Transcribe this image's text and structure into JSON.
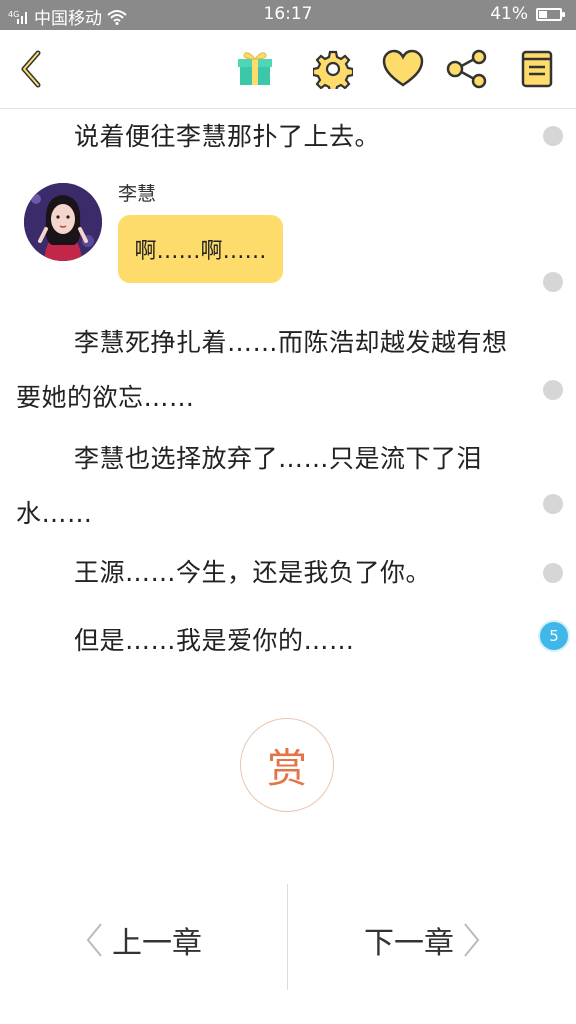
{
  "status_bar": {
    "signal_text": "4G",
    "carrier": "中国移动",
    "time": "16:17",
    "battery_percent": "41%",
    "battery_level": 0.41
  },
  "toolbar": {
    "icons": [
      "back-icon",
      "gift-icon",
      "settings-gear-icon",
      "heart-icon",
      "share-icon",
      "book-icon"
    ],
    "accent_color": "#fddc6b"
  },
  "story": {
    "paragraphs": [
      "说着便往李慧那扑了上去。",
      "李慧死挣扎着……而陈浩却越发越有想要她的欲忘……",
      "李慧也选择放弃了……只是流下了泪水……",
      "王源……今生，还是我负了你。",
      "但是……我是爱你的……"
    ],
    "dialogue": {
      "speaker": "李慧",
      "message": "啊……啊……"
    },
    "last_comment_count": "5"
  },
  "reward": {
    "label": "赏"
  },
  "chapter_nav": {
    "prev_label": "上一章",
    "next_label": "下一章"
  }
}
